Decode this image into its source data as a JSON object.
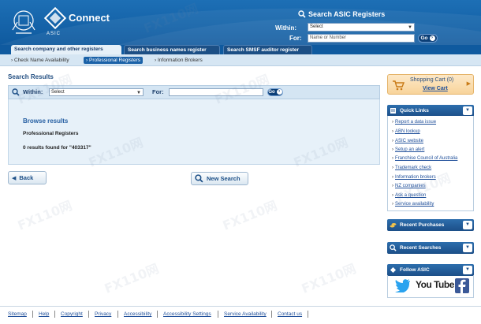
{
  "header": {
    "brand": "Connect",
    "agency": "ASIC",
    "search_title": "Search ASIC Registers",
    "within_label": "Within:",
    "within_value": "Select",
    "for_label": "For:",
    "for_placeholder": "Name or Number",
    "go_label": "Go"
  },
  "tabs": [
    {
      "label": "Search company and other registers",
      "active": true
    },
    {
      "label": "Search business names register",
      "active": false
    },
    {
      "label": "Search SMSF auditor register",
      "active": false
    }
  ],
  "subnav": [
    {
      "label": "Check Name Availability",
      "active": false
    },
    {
      "label": "Professional Registers",
      "active": true
    },
    {
      "label": "Information Brokers",
      "active": false
    }
  ],
  "main": {
    "title": "Search Results",
    "within_label": "Within:",
    "within_value": "Select",
    "for_label": "For:",
    "for_value": "",
    "go_label": "Go",
    "browse_heading": "Browse results",
    "register_name": "Professional Registers",
    "results_text": "0 results found for \"403317\"",
    "back_label": "Back",
    "new_search_label": "New Search"
  },
  "sidebar": {
    "cart_title": "Shopping Cart (0)",
    "cart_link": "View Cart",
    "quick_links_title": "Quick Links",
    "quick_links": [
      "Report a data issue",
      "ABN lookup",
      "ASIC website",
      "Setup an alert",
      "Franchise Council of Australia",
      "Trademark check",
      "Information brokers",
      "NZ companies",
      "Ask a question",
      "Service availability"
    ],
    "recent_purchases_title": "Recent Purchases",
    "recent_searches_title": "Recent Searches",
    "follow_title": "Follow ASIC",
    "youtube_text": "You Tube"
  },
  "footer": {
    "links": [
      "Sitemap",
      "Help",
      "Copyright",
      "Privacy",
      "Accessibility",
      "Accessibility Settings",
      "Service Availability",
      "Contact us"
    ]
  },
  "watermark": "FX110网",
  "colors": {
    "header_blue": "#1d6fb5",
    "nav_blue": "#0f5a9f",
    "link_blue": "#1f4f9a",
    "cart_orange": "#f8d49b"
  }
}
